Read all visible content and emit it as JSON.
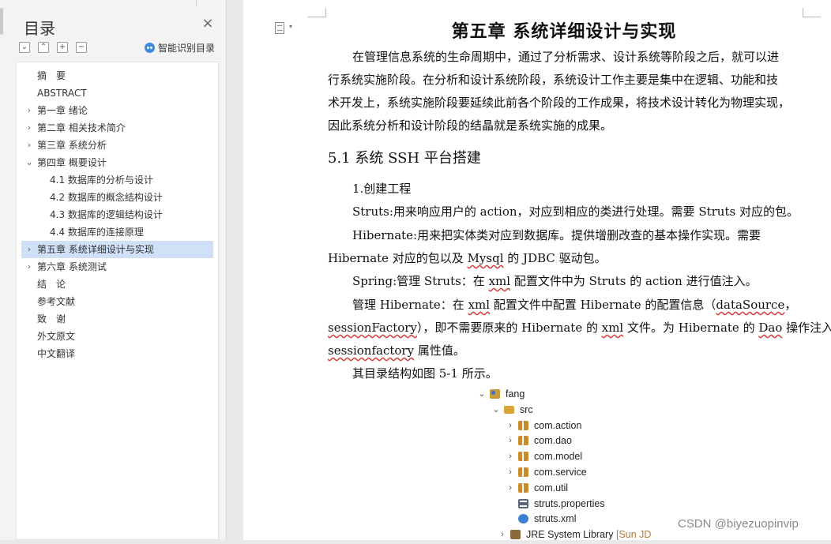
{
  "sidebar": {
    "title": "目录",
    "close_icon": "close-icon",
    "tools": [
      "collapse-all-icon",
      "expand-level-icon",
      "add-icon",
      "remove-icon"
    ],
    "smart_toc_label": "智能识别目录",
    "items": [
      {
        "label": "摘　要",
        "level": 0,
        "arrow": ""
      },
      {
        "label": "ABSTRACT",
        "level": 0,
        "arrow": ""
      },
      {
        "label": "第一章  绪论",
        "level": 0,
        "arrow": "›"
      },
      {
        "label": "第二章  相关技术简介",
        "level": 0,
        "arrow": "›"
      },
      {
        "label": "第三章  系统分析",
        "level": 0,
        "arrow": "›"
      },
      {
        "label": "第四章  概要设计",
        "level": 0,
        "arrow": "⌄"
      },
      {
        "label": "4.1 数据库的分析与设计",
        "level": 1,
        "arrow": ""
      },
      {
        "label": "4.2 数据库的概念结构设计",
        "level": 1,
        "arrow": ""
      },
      {
        "label": "4.3 数据库的逻辑结构设计",
        "level": 1,
        "arrow": ""
      },
      {
        "label": "4.4 数据库的连接原理",
        "level": 1,
        "arrow": ""
      },
      {
        "label": "第五章  系统详细设计与实现",
        "level": 0,
        "arrow": "›",
        "selected": true
      },
      {
        "label": "第六章  系统测试",
        "level": 0,
        "arrow": "›"
      },
      {
        "label": "结　论",
        "level": 0,
        "arrow": ""
      },
      {
        "label": "参考文献",
        "level": 0,
        "arrow": ""
      },
      {
        "label": "致　谢",
        "level": 0,
        "arrow": ""
      },
      {
        "label": "外文原文",
        "level": 0,
        "arrow": ""
      },
      {
        "label": "中文翻译",
        "level": 0,
        "arrow": ""
      }
    ],
    "colors": {
      "selected": "#cfe0f7",
      "smart_icon": "#3d8be0"
    }
  },
  "document": {
    "chapter_title": "第五章  系统详细设计与实现",
    "intro": {
      "l1": "在管理信息系统的生命周期中，通过了分析需求、设计系统等阶段之后，就可以进",
      "l2": "行系统实施阶段。在分析和设计系统阶段，系统设计工作主要是集中在逻辑、功能和技",
      "l3": "术开发上，系统实施阶段要延续此前各个阶段的工作成果，将技术设计转化为物理实现，",
      "l4": "因此系统分析和设计阶段的结晶就是系统实施的成果。"
    },
    "section_title": "5.1 系统 SSH 平台搭建",
    "step1": "1.创建工程",
    "struts_line": "Struts:用来响应用户的 action，对应到相应的类进行处理。需要 Struts 对应的包。",
    "hibernate": {
      "l1": "Hibernate:用来把实体类对应到数据库。提供增删改查的基本操作实现。需要",
      "l2_a": "Hibernate 对应的包以及 ",
      "l2_mysql": "Mysql",
      "l2_b": " 的 JDBC 驱动包。"
    },
    "spring": {
      "a": "Spring:管理 Struts：在 ",
      "xml": "xml",
      "b": " 配置文件中为 Struts 的 action 进行值注入。"
    },
    "manage": {
      "l1_a": "管理 Hibernate：在 ",
      "l1_xml": "xml",
      "l1_b": " 配置文件中配置 Hibernate 的配置信息（",
      "l1_ds": "dataSource",
      "l1_c": "，",
      "l2_sf": "sessionFactory",
      "l2_a": "），即不需要原来的 Hibernate 的 ",
      "l2_xml": "xml",
      "l2_b": " 文件。为 Hibernate 的 ",
      "l2_dao": "Dao",
      "l2_c": " 操作注入",
      "l3_sf": "sessionfactory",
      "l3_a": " 属性值。"
    },
    "figure_ref": "其目录结构如图 5-1 所示。",
    "underline_color": "#d43b3b"
  },
  "tree": {
    "rows": [
      {
        "label": "fang",
        "icon": "project",
        "arrow": "⌄"
      },
      {
        "label": "src",
        "icon": "folder",
        "arrow": "⌄"
      },
      {
        "label": "com.action",
        "icon": "pkg",
        "arrow": "›"
      },
      {
        "label": "com.dao",
        "icon": "pkg",
        "arrow": "›"
      },
      {
        "label": "com.model",
        "icon": "pkg",
        "arrow": "›"
      },
      {
        "label": "com.service",
        "icon": "pkg",
        "arrow": "›"
      },
      {
        "label": "com.util",
        "icon": "pkg",
        "arrow": "›"
      },
      {
        "label": "struts.properties",
        "icon": "props",
        "arrow": ""
      },
      {
        "label": "struts.xml",
        "icon": "xml",
        "arrow": ""
      },
      {
        "label": "JRE System Library",
        "icon": "lib",
        "arrow": "›",
        "suffix": "[Sun JD"
      }
    ]
  },
  "watermark": "CSDN @biyezuopinvip"
}
